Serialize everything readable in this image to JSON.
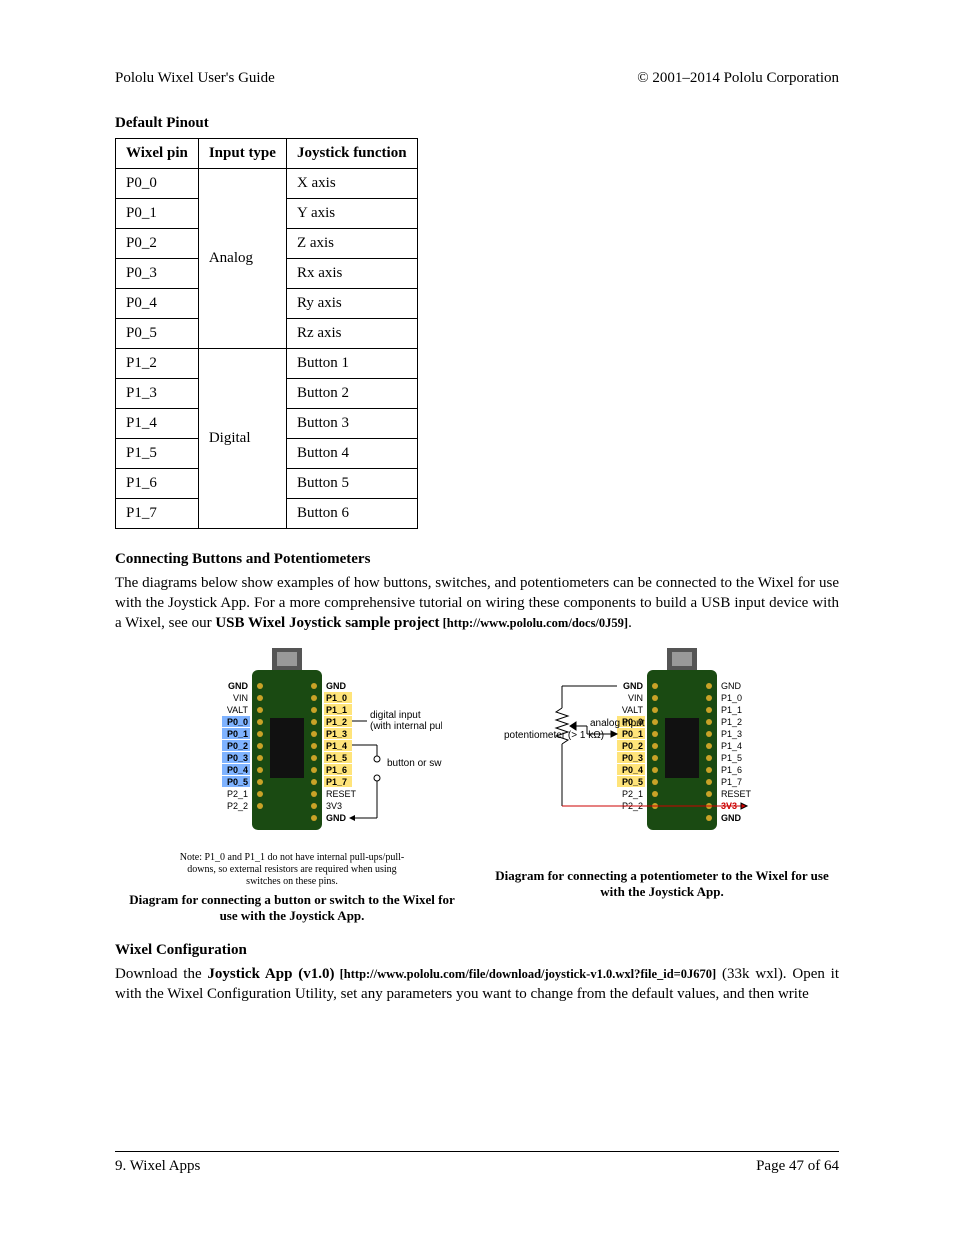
{
  "header": {
    "left": "Pololu Wixel User's Guide",
    "right": "© 2001–2014 Pololu Corporation"
  },
  "section1_title": "Default Pinout",
  "table": {
    "headers": [
      "Wixel pin",
      "Input type",
      "Joystick function"
    ],
    "group1_type": "Analog",
    "group1": [
      {
        "pin": "P0_0",
        "fn": "X axis"
      },
      {
        "pin": "P0_1",
        "fn": "Y axis"
      },
      {
        "pin": "P0_2",
        "fn": "Z axis"
      },
      {
        "pin": "P0_3",
        "fn": "Rx axis"
      },
      {
        "pin": "P0_4",
        "fn": "Ry axis"
      },
      {
        "pin": "P0_5",
        "fn": "Rz axis"
      }
    ],
    "group2_type": "Digital",
    "group2": [
      {
        "pin": "P1_2",
        "fn": "Button 1"
      },
      {
        "pin": "P1_3",
        "fn": "Button 2"
      },
      {
        "pin": "P1_4",
        "fn": "Button 3"
      },
      {
        "pin": "P1_5",
        "fn": "Button 4"
      },
      {
        "pin": "P1_6",
        "fn": "Button 5"
      },
      {
        "pin": "P1_7",
        "fn": "Button 6"
      }
    ]
  },
  "section2_title": "Connecting Buttons and Potentiometers",
  "para1_a": "The diagrams below show examples of how buttons, switches, and potentiometers can be connected to the Wixel for use with the Joystick App. For a more comprehensive tutorial on wiring these components to build a USB input device with a Wixel, see our ",
  "para1_link_text": "USB Wixel Joystick sample project",
  "para1_link_url": " [http://www.pololu.com/docs/0J59]",
  "para1_b": ".",
  "fig1": {
    "left_pins_bold": [
      "GND",
      "VIN",
      "VALT"
    ],
    "left_pins_hl": [
      "P0_0",
      "P0_1",
      "P0_2",
      "P0_3",
      "P0_4",
      "P0_5"
    ],
    "left_pins_plain": [
      "P2_1",
      "P2_2"
    ],
    "right_pins_top": "GND",
    "right_pins_hl": [
      "P1_0",
      "P1_1",
      "P1_2",
      "P1_3",
      "P1_4",
      "P1_5",
      "P1_6",
      "P1_7"
    ],
    "right_pins_plain": [
      "RESET",
      "3V3",
      "GND"
    ],
    "annot1": "digital input",
    "annot1b": "(with internal pull-up enabled)",
    "annot2": "button or switch",
    "note": "Note: P1_0 and P1_1 do not have internal pull-ups/pull-downs, so external resistors are required when using switches on these pins.",
    "caption": "Diagram for connecting a button or switch to the Wixel for use with the Joystick App."
  },
  "fig2": {
    "left_pins_bold": [
      "GND",
      "VIN",
      "VALT"
    ],
    "left_pins_hl": [
      "P0_0",
      "P0_1",
      "P0_2",
      "P0_3",
      "P0_4",
      "P0_5"
    ],
    "left_pins_plain": [
      "P2_1",
      "P2_2"
    ],
    "right_pins_top": "GND",
    "right_pins_plain": [
      "P1_0",
      "P1_1",
      "P1_2",
      "P1_3",
      "P1_4",
      "P1_5",
      "P1_6",
      "P1_7",
      "RESET"
    ],
    "right_pins_red": "3V3",
    "right_pins_gnd": "GND",
    "annot1": "analog input",
    "annot2": "potentiometer (> 1 kΩ)",
    "caption": "Diagram for connecting a potentiometer to the Wixel for use with the Joystick App."
  },
  "section3_title": "Wixel Configuration",
  "para2_a": "Download the ",
  "para2_link_text": "Joystick App (v1.0)",
  "para2_link_url": " [http://www.pololu.com/file/download/joystick-v1.0.wxl?file_id=0J670]",
  "para2_b": " (33k wxl). Open it with the Wixel Configuration Utility, set any parameters you want to change from the default values, and then write",
  "footer": {
    "left": "9. Wixel Apps",
    "right": "Page 47 of 64"
  }
}
